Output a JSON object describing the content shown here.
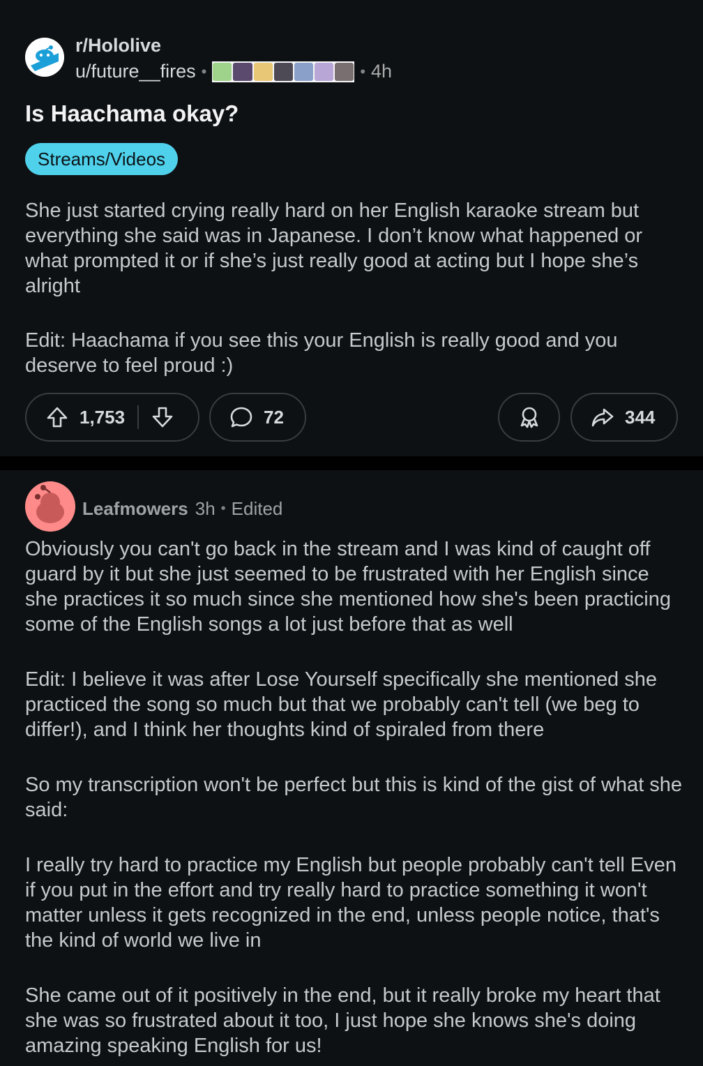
{
  "post": {
    "subreddit": "r/Hololive",
    "author": "u/future__fires",
    "time": "4h",
    "title": "Is Haachama okay?",
    "flair": "Streams/Videos",
    "flair_color": "#4fd1ec",
    "body": [
      "She just started crying really hard on her English karaoke stream but everything she said was in Japanese. I don’t know what happened or what prompted it or if she’s just really good at acting but I hope she’s alright",
      "Edit: Haachama if you see this your English is really good and you deserve to feel proud :)"
    ],
    "upvotes": "1,753",
    "comments": "72",
    "shares": "344"
  },
  "comment": {
    "author": "Leafmowers",
    "time": "3h",
    "edited": "Edited",
    "avatar_color": "#ff8a8a",
    "body": [
      "Obviously you can't go back in the stream and I was kind of caught off guard by it but she just seemed to be frustrated with her English since she practices it so much since she mentioned how she's been practicing some of the English songs a lot just before that as well",
      "Edit: I believe it was after Lose Yourself specifically she mentioned she practiced the song so much but that we probably can't tell (we beg to differ!), and I think her thoughts kind of spiraled from there",
      "So my transcription won't be perfect but this is kind of the gist of what she said:",
      "I really try hard to practice my English but people probably can't tell Even if you put in the effort and try really hard to practice something it won't matter unless it gets recognized in the end, unless people notice, that's the kind of world we live in",
      "She came out of it positively in the end, but it really broke my heart that she was so frustrated about it too, I just hope she knows she's doing amazing speaking English for us!"
    ]
  },
  "icons": {
    "subreddit_avatar": "reddit-snoo-icon",
    "upvote": "upvote-arrow-icon",
    "downvote": "downvote-arrow-icon",
    "comment": "comment-bubble-icon",
    "award": "award-icon",
    "share": "share-arrow-icon"
  }
}
